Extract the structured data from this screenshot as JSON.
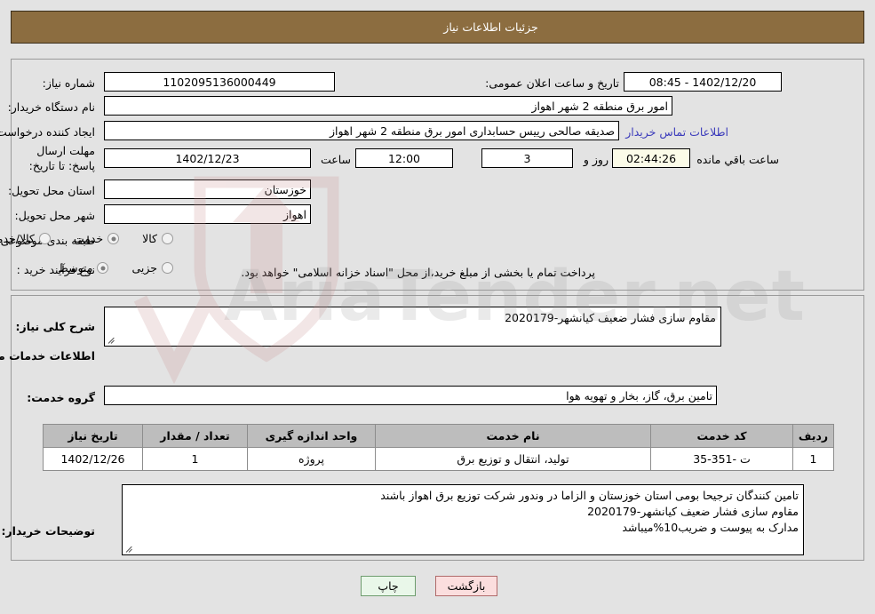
{
  "window": {
    "title": "جزئیات اطلاعات نیاز"
  },
  "top_section": {
    "fields": {
      "need_number_label": "شماره نیاز:",
      "need_number_value": "1102095136000449",
      "announce_datetime_label": "تاریخ و ساعت اعلان عمومی:",
      "announce_datetime_value": "1402/12/20 - 08:45",
      "buyer_org_label": "نام دستگاه خریدار:",
      "buyer_org_value": "امور برق منطقه 2 شهر اهواز",
      "requester_label": "ایجاد کننده درخواست:",
      "requester_value": "صدیقه صالحی رییس حسابداری امور برق منطقه 2 شهر اهواز",
      "contact_link": "اطلاعات تماس خریدار",
      "deadline_label": "مهلت ارسال پاسخ: تا تاریخ:",
      "deadline_date": "1402/12/23",
      "hour_label": "ساعت",
      "deadline_time": "12:00",
      "days_remaining": "3",
      "days_label": "روز و",
      "time_remaining": "02:44:26",
      "time_remaining_label": "ساعت باقي مانده",
      "province_label": "استان محل تحویل:",
      "province_value": "خوزستان",
      "city_label": "شهر محل تحویل:",
      "city_value": "اهواز",
      "category_label": "طبقه بندی موضوعی:",
      "process_type_label": "نوع فرآیند خرید :",
      "payment_note": "پرداخت تمام یا بخشی از مبلغ خرید،از محل \"اسناد خزانه اسلامی\" خواهد بود."
    },
    "category_options": [
      {
        "label": "کالا",
        "selected": false
      },
      {
        "label": "خدمت",
        "selected": true
      },
      {
        "label": "کالا/خدمت",
        "selected": false
      }
    ],
    "process_options": [
      {
        "label": "جزیی",
        "selected": false
      },
      {
        "label": "متوسط",
        "selected": true
      }
    ]
  },
  "mid_section": {
    "general_desc_label": "شرح کلی نیاز:",
    "general_desc_value": "مقاوم سازی فشار ضعیف کیانشهر-2020179",
    "services_info_heading": "اطلاعات خدمات مورد نیاز",
    "service_group_label": "گروه خدمت:",
    "service_group_value": "تامین برق، گاز، بخار و تهویه هوا",
    "table": {
      "headers": [
        "ردیف",
        "کد خدمت",
        "نام خدمت",
        "واحد اندازه گیری",
        "تعداد / مقدار",
        "تاریخ نیاز"
      ],
      "rows": [
        {
          "row_no": "1",
          "service_code": "ت -351-35",
          "service_name": "تولید، انتقال و توزیع برق",
          "unit": "پروژه",
          "quantity": "1",
          "need_date": "1402/12/26"
        }
      ]
    },
    "buyer_notes_label": "توضیحات خریدار:",
    "buyer_notes_lines": [
      "تامین کنندگان ترجیحا بومی استان خوزستان و الزاما در وندور شرکت توزیع برق اهواز باشند",
      "مقاوم سازی فشار ضعیف کیانشهر-2020179",
      "مدارک به پیوست و ضریب10%میباشد"
    ]
  },
  "footer": {
    "print_button": "چاپ",
    "back_button": "بازگشت"
  },
  "colors": {
    "titlebar_bg": "#8c6d40",
    "titlebar_text": "#ffffff",
    "panel_bg": "#e3e3e3",
    "table_header_bg": "#bdbdbd",
    "link": "#3b3bbb",
    "countdown_bg": "#fbfbe8",
    "print_bg": "#e9f7e9",
    "back_bg": "#fbdede"
  },
  "watermark": {
    "text": "AriaTender.net"
  }
}
